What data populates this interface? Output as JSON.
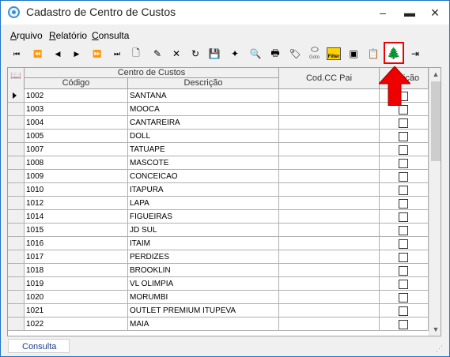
{
  "window": {
    "title": "Cadastro de Centro de Custos",
    "minimize_glyph": "–",
    "maximize_glyph": "▬",
    "close_glyph": "×"
  },
  "menu": {
    "items": [
      {
        "accel": "A",
        "rest": "rquivo"
      },
      {
        "accel": "R",
        "rest": "elatório"
      },
      {
        "accel": "C",
        "rest": "onsulta"
      }
    ]
  },
  "toolbar": {
    "goto_label": "Goto",
    "filter_label": "Filter",
    "first_glyph": "⏮",
    "prev_page_glyph": "⏪",
    "prev_glyph": "◀",
    "next_glyph": "▶",
    "next_page_glyph": "⏩",
    "last_glyph": "⏭",
    "new_glyph": "🗋",
    "edit_glyph": "✎",
    "delete_glyph": "✕",
    "refresh_glyph": "↻",
    "save_glyph": "💾",
    "wand_glyph": "✦",
    "preview_glyph": "🔍",
    "print_glyph": "🖶",
    "tag_glyph": "🏷",
    "photo_glyph": "▣",
    "export_glyph": "📋",
    "tree_glyph": "🌲",
    "exit_glyph": "⇥"
  },
  "grid": {
    "group_header": "Centro de Custos",
    "columns": [
      "Código",
      "Descrição",
      "Cod.CC Pai",
      "Posição"
    ],
    "rows": [
      {
        "codigo": "1002",
        "descricao": "SANTANA",
        "cc_pai": "",
        "current": true
      },
      {
        "codigo": "1003",
        "descricao": "MOOCA",
        "cc_pai": ""
      },
      {
        "codigo": "1004",
        "descricao": "CANTAREIRA",
        "cc_pai": ""
      },
      {
        "codigo": "1005",
        "descricao": "DOLL",
        "cc_pai": ""
      },
      {
        "codigo": "1007",
        "descricao": "TATUAPE",
        "cc_pai": ""
      },
      {
        "codigo": "1008",
        "descricao": "MASCOTE",
        "cc_pai": ""
      },
      {
        "codigo": "1009",
        "descricao": "CONCEICAO",
        "cc_pai": ""
      },
      {
        "codigo": "1010",
        "descricao": "ITAPURA",
        "cc_pai": ""
      },
      {
        "codigo": "1012",
        "descricao": "LAPA",
        "cc_pai": ""
      },
      {
        "codigo": "1014",
        "descricao": "FIGUEIRAS",
        "cc_pai": ""
      },
      {
        "codigo": "1015",
        "descricao": "JD SUL",
        "cc_pai": ""
      },
      {
        "codigo": "1016",
        "descricao": "ITAIM",
        "cc_pai": ""
      },
      {
        "codigo": "1017",
        "descricao": "PERDIZES",
        "cc_pai": ""
      },
      {
        "codigo": "1018",
        "descricao": "BROOKLIN",
        "cc_pai": ""
      },
      {
        "codigo": "1019",
        "descricao": "VL OLIMPIA",
        "cc_pai": ""
      },
      {
        "codigo": "1020",
        "descricao": "MORUMBI",
        "cc_pai": ""
      },
      {
        "codigo": "1021",
        "descricao": "OUTLET PREMIUM ITUPEVA",
        "cc_pai": ""
      },
      {
        "codigo": "1022",
        "descricao": "MAIA",
        "cc_pai": ""
      }
    ]
  },
  "statusbar": {
    "tab_label": "Consulta"
  },
  "colors": {
    "window_border": "#1e73c8",
    "highlight_border": "#ee0000",
    "arrow_fill": "#ee0000",
    "status_text": "#1a3c8c"
  }
}
